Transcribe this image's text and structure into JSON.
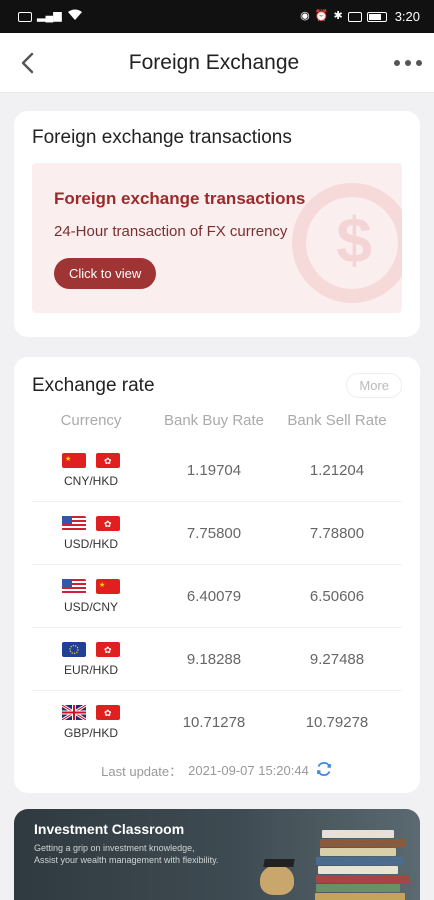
{
  "status": {
    "time": "3:20",
    "left_icons": [
      "sim-icon",
      "signal-icon",
      "wifi-icon"
    ],
    "right_icons": [
      "eye-icon",
      "alarm-icon",
      "bluetooth-icon",
      "mute-icon",
      "battery-icon"
    ]
  },
  "nav": {
    "title": "Foreign Exchange"
  },
  "fx_card": {
    "title": "Foreign exchange transactions",
    "banner_title": "Foreign exchange transactions",
    "banner_subtitle": "24-Hour transaction of FX currency",
    "button_label": "Click to view"
  },
  "rate_card": {
    "title": "Exchange rate",
    "more_label": "More",
    "columns": [
      "Currency",
      "Bank Buy Rate",
      "Bank Sell Rate"
    ],
    "rows": [
      {
        "pair": "CNY/HKD",
        "buy": "1.19704",
        "sell": "1.21204"
      },
      {
        "pair": "USD/HKD",
        "buy": "7.75800",
        "sell": "7.78800"
      },
      {
        "pair": "USD/CNY",
        "buy": "6.40079",
        "sell": "6.50606"
      },
      {
        "pair": "EUR/HKD",
        "buy": "9.18288",
        "sell": "9.27488"
      },
      {
        "pair": "GBP/HKD",
        "buy": "10.71278",
        "sell": "10.79278"
      }
    ],
    "last_update_label": "Last update：",
    "last_update_value": "2021-09-07 15:20:44"
  },
  "invest_card": {
    "title": "Investment Classroom",
    "subtitle_1": "Getting a grip on investment knowledge,",
    "subtitle_2": "Assist your wealth management with flexibility."
  },
  "colors": {
    "accent": "#9f3434",
    "refresh": "#3f8be0",
    "bg": "#f1f1f3"
  }
}
